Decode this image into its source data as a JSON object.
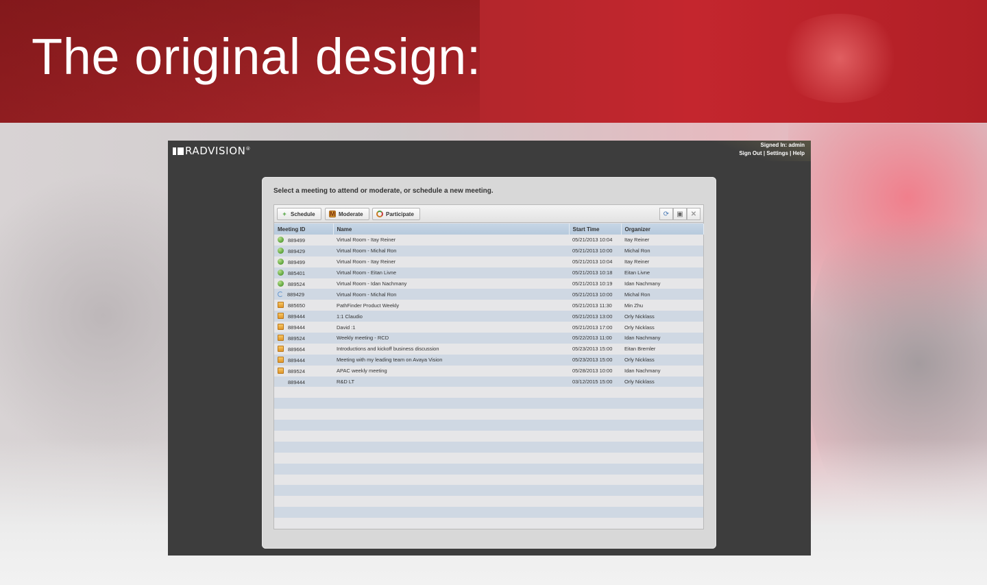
{
  "slide": {
    "title": "The original design:"
  },
  "app": {
    "brand": "RADVISION",
    "brand_mark": "®",
    "signed_in": "Signed In: admin",
    "links": [
      "Sign Out",
      "Settings",
      "Help"
    ],
    "link_separator": "|"
  },
  "panel": {
    "prompt": "Select a meeting to attend or moderate, or schedule a new meeting.",
    "toolbar": {
      "schedule_label": "Schedule",
      "moderate_label": "Moderate",
      "participate_label": "Participate",
      "icons": [
        "refresh-icon",
        "export-icon",
        "close-icon"
      ]
    },
    "columns": [
      "Meeting ID",
      "Name",
      "Start Time",
      "Organizer"
    ],
    "rows": [
      {
        "status": "green",
        "id": "889499",
        "name": "Virtual Room - Itay Reiner",
        "start": "05/21/2013 10:04",
        "organizer": "Itay Reiner"
      },
      {
        "status": "green",
        "id": "889429",
        "name": "Virtual Room - Michal Ron",
        "start": "05/21/2013 10:00",
        "organizer": "Michal Ron"
      },
      {
        "status": "green",
        "id": "889499",
        "name": "Virtual Room - Itay Reiner",
        "start": "05/21/2013 10:04",
        "organizer": "Itay Reiner"
      },
      {
        "status": "green",
        "id": "885401",
        "name": "Virtual Room - Eitan Livne",
        "start": "05/21/2013 10:18",
        "organizer": "Eitan Livne"
      },
      {
        "status": "green",
        "id": "889524",
        "name": "Virtual Room - Idan Nachmany",
        "start": "05/21/2013 10:19",
        "organizer": "Idan Nachmany"
      },
      {
        "status": "sync",
        "id": "889429",
        "name": "Virtual Room - Michal Ron",
        "start": "05/21/2013 10:00",
        "organizer": "Michal Ron"
      },
      {
        "status": "sched",
        "id": "885650",
        "name": "PathFinder Product Weekly",
        "start": "05/21/2013 11:30",
        "organizer": "Min Zhu"
      },
      {
        "status": "sched",
        "id": "889444",
        "name": "1:1 Claudio",
        "start": "05/21/2013 13:00",
        "organizer": "Orly Nicklass"
      },
      {
        "status": "sched",
        "id": "889444",
        "name": "David :1",
        "start": "05/21/2013 17:00",
        "organizer": "Orly Nicklass"
      },
      {
        "status": "sched",
        "id": "889524",
        "name": "Weekly meeting - RCD",
        "start": "05/22/2013 11:00",
        "organizer": "Idan Nachmany"
      },
      {
        "status": "sched",
        "id": "889664",
        "name": "Introductions and kickoff business discussion",
        "start": "05/23/2013 15:00",
        "organizer": "Eitan Bremler"
      },
      {
        "status": "sched",
        "id": "889444",
        "name": "Meeting with my leading team on Avaya Vision",
        "start": "05/23/2013 15:00",
        "organizer": "Orly Nicklass"
      },
      {
        "status": "sched",
        "id": "889524",
        "name": "APAC weekly meeting",
        "start": "05/28/2013 10:00",
        "organizer": "Idan Nachmany"
      },
      {
        "status": "none",
        "id": "889444",
        "name": "R&D LT",
        "start": "03/12/2015 15:00",
        "organizer": "Orly Nicklass"
      }
    ],
    "empty_rows": 13
  }
}
